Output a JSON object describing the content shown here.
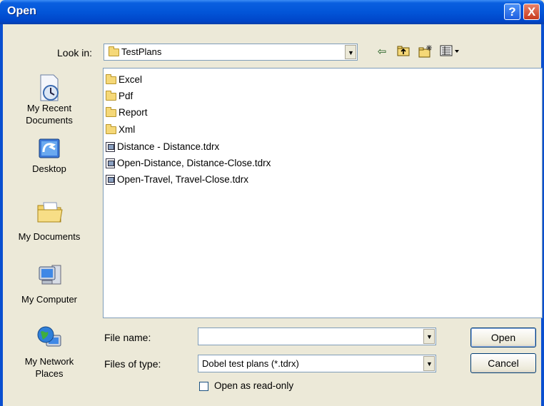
{
  "window": {
    "title": "Open"
  },
  "titlebar": {
    "help_label": "?",
    "close_label": "X"
  },
  "look_in": {
    "label": "Look in:",
    "value": "TestPlans"
  },
  "toolbar": {
    "icons": [
      "back-icon",
      "up-folder-icon",
      "new-folder-icon",
      "view-menu-icon"
    ]
  },
  "places": [
    {
      "label": "My Recent Documents",
      "icon": "recent-documents-icon"
    },
    {
      "label": "Desktop",
      "icon": "desktop-icon"
    },
    {
      "label": "My Documents",
      "icon": "my-documents-icon"
    },
    {
      "label": "My Computer",
      "icon": "my-computer-icon"
    },
    {
      "label": "My Network Places",
      "icon": "network-places-icon"
    }
  ],
  "files": [
    {
      "name": "Excel",
      "kind": "folder"
    },
    {
      "name": "Pdf",
      "kind": "folder"
    },
    {
      "name": "Report",
      "kind": "folder"
    },
    {
      "name": "Xml",
      "kind": "folder"
    },
    {
      "name": "Distance - Distance.tdrx",
      "kind": "file"
    },
    {
      "name": "Open-Distance, Distance-Close.tdrx",
      "kind": "file"
    },
    {
      "name": "Open-Travel, Travel-Close.tdrx",
      "kind": "file"
    }
  ],
  "file_name": {
    "label": "File name:",
    "value": ""
  },
  "file_type": {
    "label": "Files of type:",
    "value": "Dobel test plans (*.tdrx)"
  },
  "read_only": {
    "label": "Open as read-only",
    "checked": false
  },
  "buttons": {
    "open": "Open",
    "cancel": "Cancel"
  }
}
